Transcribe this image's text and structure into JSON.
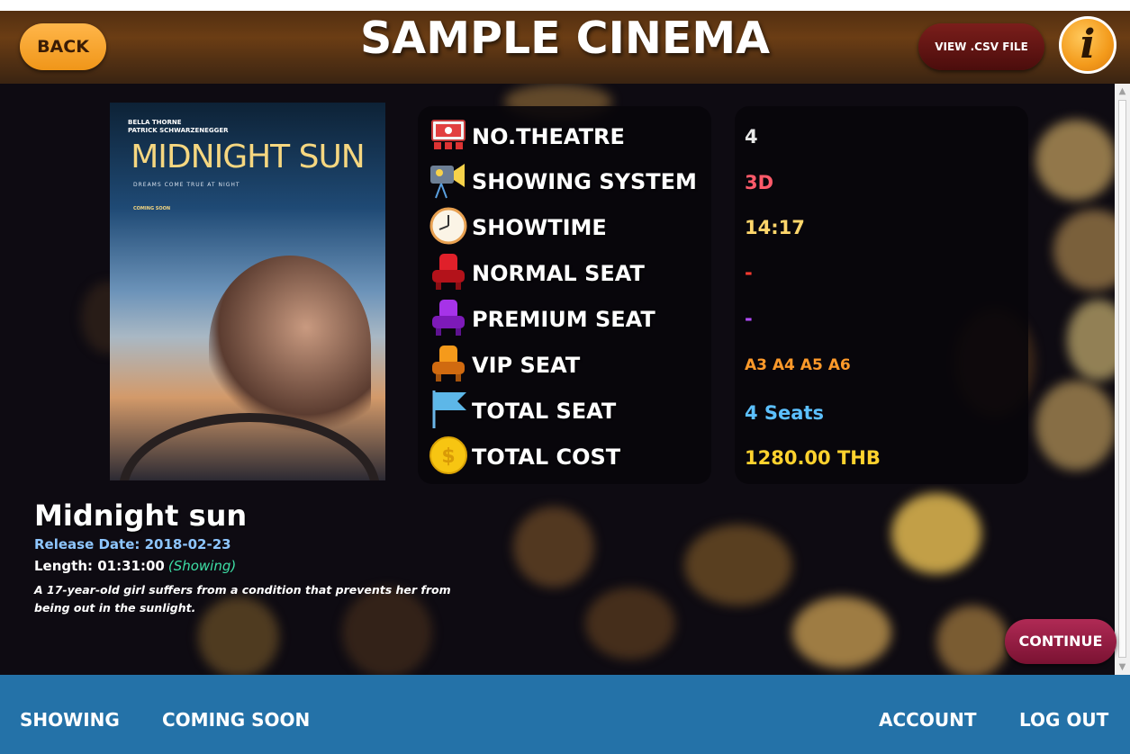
{
  "header": {
    "back_label": "BACK",
    "title": "SAMPLE CINEMA",
    "csv_label": "VIEW .CSV FILE",
    "info_glyph": "i"
  },
  "poster": {
    "actors_line1": "BELLA THORNE",
    "actors_line2": "PATRICK SCHWARZENEGGER",
    "title": "MIDNIGHT SUN",
    "tagline": "DREAMS COME TRUE AT NIGHT",
    "coming_soon": "COMING SOON"
  },
  "details": {
    "rows": [
      {
        "label": "NO.THEATRE",
        "icon": "theatre-icon",
        "value": "4",
        "color": "#e8e8e8"
      },
      {
        "label": "SHOWING SYSTEM",
        "icon": "projector-icon",
        "value": "3D",
        "color": "#ff5a6a"
      },
      {
        "label": "SHOWTIME",
        "icon": "clock-icon",
        "value": "14:17",
        "color": "#ffd66b"
      },
      {
        "label": "NORMAL SEAT",
        "icon": "red-seat-icon",
        "value": "-",
        "color": "#ff3b30"
      },
      {
        "label": "PREMIUM SEAT",
        "icon": "purple-seat-icon",
        "value": "-",
        "color": "#b24cff"
      },
      {
        "label": "VIP SEAT",
        "icon": "orange-seat-icon",
        "value": "A3 A4 A5 A6",
        "color": "#ff9a2a"
      },
      {
        "label": "TOTAL SEAT",
        "icon": "flag-icon",
        "value": "4 Seats",
        "color": "#5cc0ff"
      },
      {
        "label": "TOTAL COST",
        "icon": "coin-icon",
        "value": "1280.00 THB",
        "color": "#ffd22e"
      }
    ]
  },
  "movie": {
    "title": "Midnight sun",
    "release": "Release Date: 2018-02-23",
    "length": "Length: 01:31:00",
    "status": "(Showing)",
    "description": "A 17-year-old girl suffers from a condition that prevents her from being out in the sunlight."
  },
  "continue_label": "CONTINUE",
  "footer": {
    "showing": "SHOWING",
    "coming_soon": "COMING SOON",
    "account": "ACCOUNT",
    "logout": "LOG OUT"
  }
}
